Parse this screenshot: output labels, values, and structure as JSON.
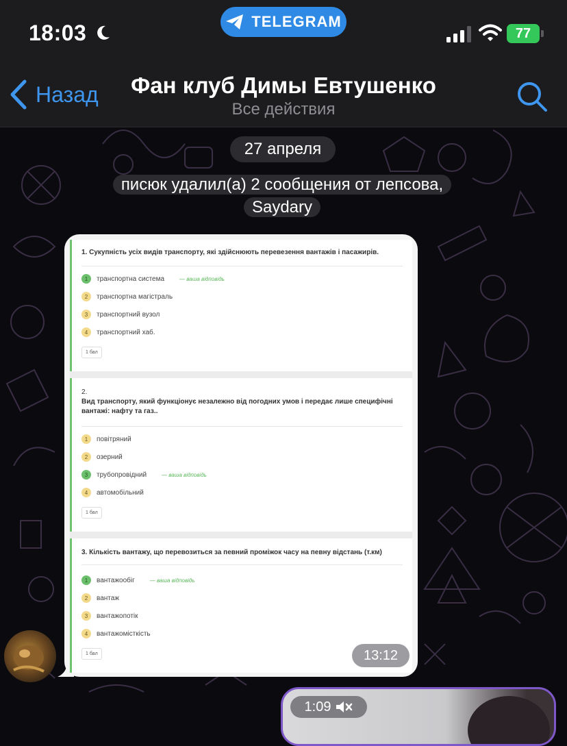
{
  "status_bar": {
    "time": "18:03",
    "app_pill": "TELEGRAM",
    "battery": "77"
  },
  "nav": {
    "back_label": "Назад",
    "title": "Фан клуб Димы Евтушенко",
    "subtitle": "Все действия"
  },
  "chat": {
    "date": "27 апреля",
    "service_message": "писюк удалил(а) 2 сообщения от лепсова, Saydary",
    "message_time": "13:12",
    "video_duration": "1:09"
  },
  "quiz": {
    "answer_mark": "— ваша відповідь",
    "score": "1 бал",
    "questions": [
      {
        "number": "",
        "text": "1. Сукупність усіх видів транспорту, які здійснюють перевезення вантажів і пасажирів.",
        "options": [
          {
            "num": "1",
            "text": "транспортна система",
            "correct": true
          },
          {
            "num": "2",
            "text": "транспортна магістраль",
            "correct": false
          },
          {
            "num": "3",
            "text": "транспортний вузол",
            "correct": false
          },
          {
            "num": "4",
            "text": "транспортний хаб.",
            "correct": false
          }
        ]
      },
      {
        "number": "2.",
        "text": "Вид транспорту, який функціонує незалежно від погодних умов і передає лише специфічні вантажі: нафту та газ..",
        "options": [
          {
            "num": "1",
            "text": "повітряний",
            "correct": false
          },
          {
            "num": "2",
            "text": "озерний",
            "correct": false
          },
          {
            "num": "3",
            "text": "трубопровідний",
            "correct": true
          },
          {
            "num": "4",
            "text": "автомобільний",
            "correct": false
          }
        ]
      },
      {
        "number": "",
        "text": "3. Кількість вантажу, що перевозиться за певний проміжок часу на певну відстань (т.км)",
        "options": [
          {
            "num": "1",
            "text": "вантажообіг",
            "correct": true
          },
          {
            "num": "2",
            "text": "вантаж",
            "correct": false
          },
          {
            "num": "3",
            "text": "вантажопотік",
            "correct": false
          },
          {
            "num": "4",
            "text": "вантажомісткість",
            "correct": false
          }
        ]
      }
    ]
  },
  "colors": {
    "accent": "#3e96ef",
    "telegram_pill": "#2f8ae5",
    "battery": "#34c759",
    "bar_background": "#1c1c1e",
    "correct": "#6cbf6c",
    "option": "#f3d98a"
  },
  "icons": [
    "moon-icon",
    "telegram-plane-icon",
    "signal-icon",
    "wifi-icon",
    "back-chevron-icon",
    "search-icon",
    "mute-icon"
  ]
}
